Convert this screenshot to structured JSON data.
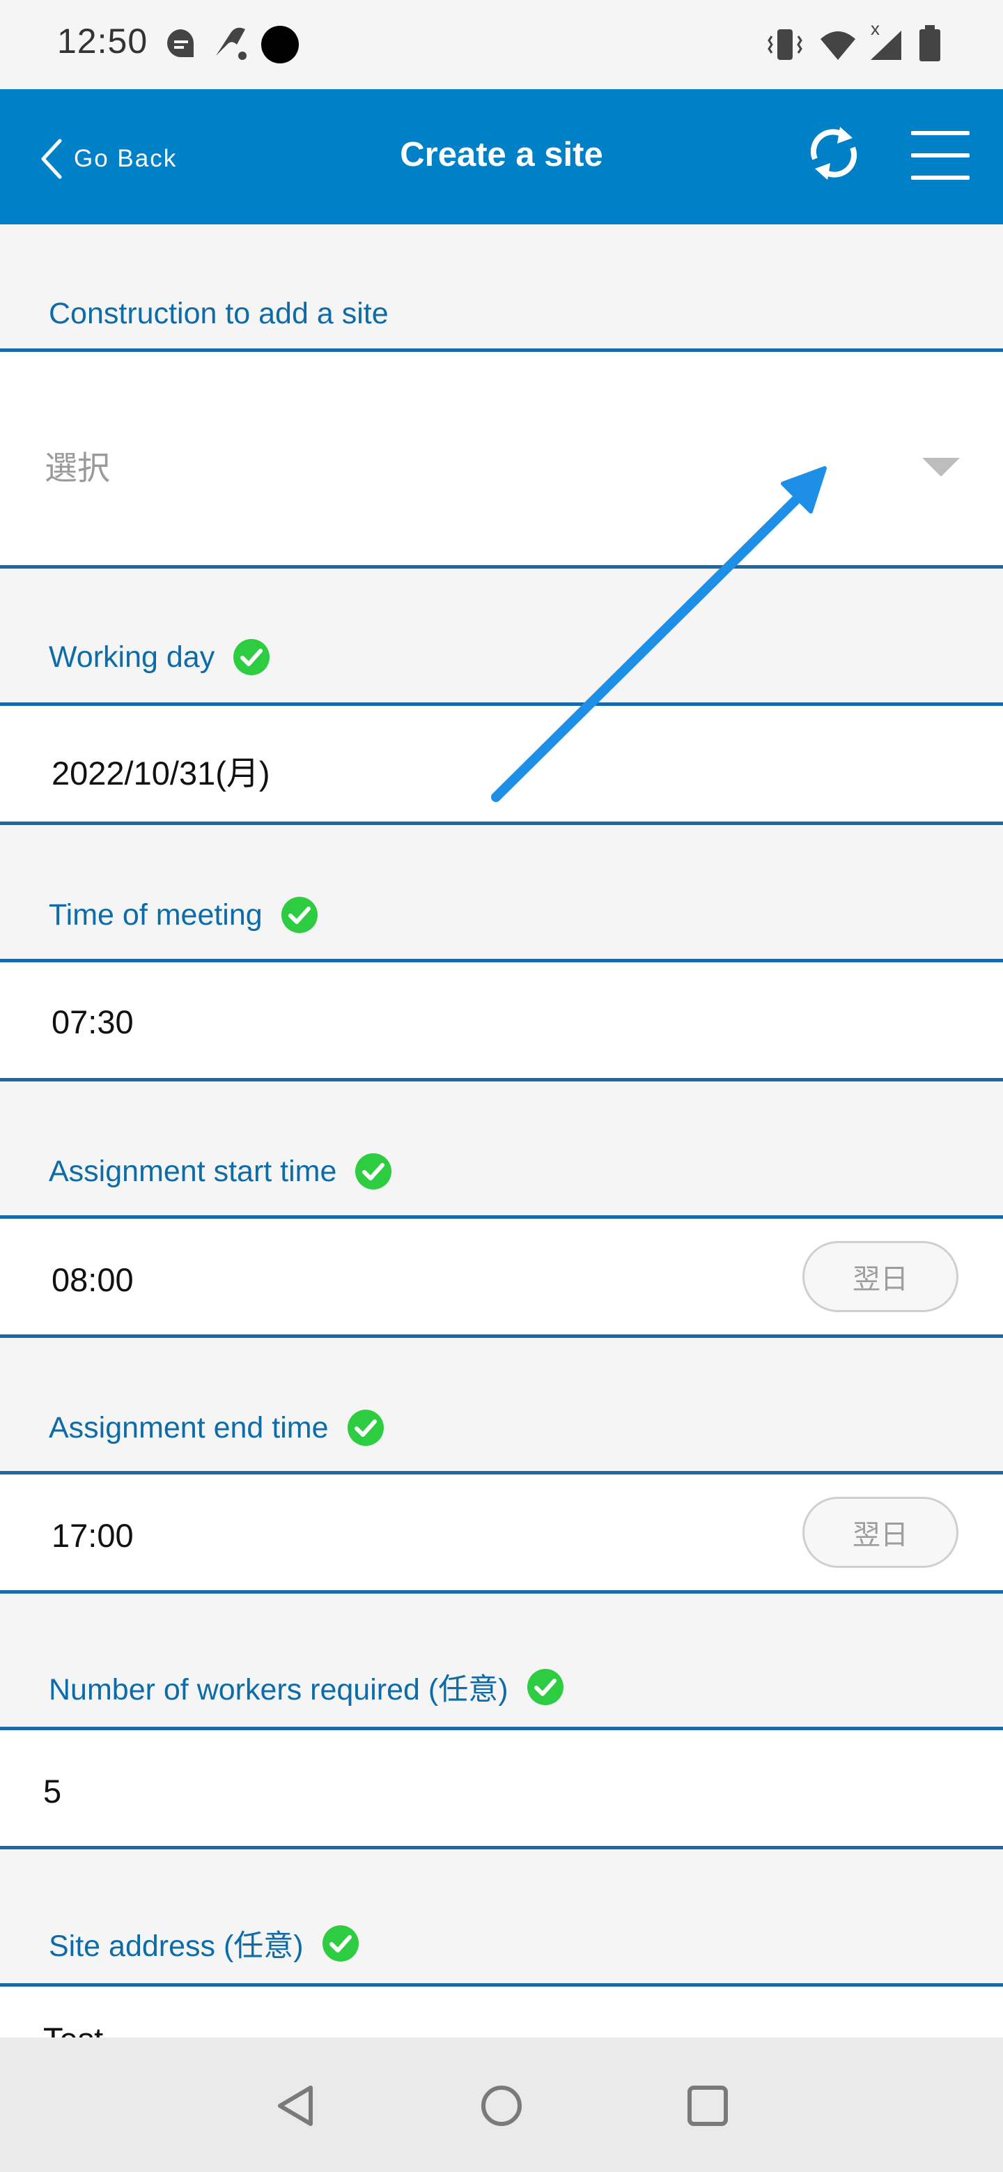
{
  "status_bar": {
    "time": "12:50",
    "left_icons": [
      "chat-bubble-icon",
      "telecom-icon",
      "record-dot-icon"
    ],
    "right_icons": [
      "vibrate-icon",
      "wifi-icon",
      "signal-icon",
      "battery-icon"
    ],
    "signal_badge": "x"
  },
  "app_bar": {
    "back_label": "Go Back",
    "title": "Create a site",
    "refresh_icon": "refresh-icon",
    "menu_icon": "hamburger-menu-icon",
    "color": "#0081c7"
  },
  "form": {
    "construction": {
      "label": "Construction to add a site",
      "placeholder": "選択"
    },
    "working_day": {
      "label": "Working day",
      "value": "2022/10/31(月)"
    },
    "meeting_time": {
      "label": "Time of meeting",
      "value": "07:30"
    },
    "start_time": {
      "label": "Assignment start time",
      "value": "08:00",
      "next_day_label": "翌日"
    },
    "end_time": {
      "label": "Assignment end time",
      "value": "17:00",
      "next_day_label": "翌日"
    },
    "workers": {
      "label": "Number of workers required (任意)",
      "value": "5"
    },
    "address": {
      "label": "Site address (任意)",
      "value": "Test"
    }
  },
  "colors": {
    "label_text": "#0d6ca8",
    "border": "#1b6aa8",
    "check": "#2ecc40",
    "annotation_arrow": "#1e8fe6"
  },
  "nav_bar": {
    "icons": [
      "back-triangle-icon",
      "home-circle-icon",
      "recents-square-icon"
    ]
  }
}
